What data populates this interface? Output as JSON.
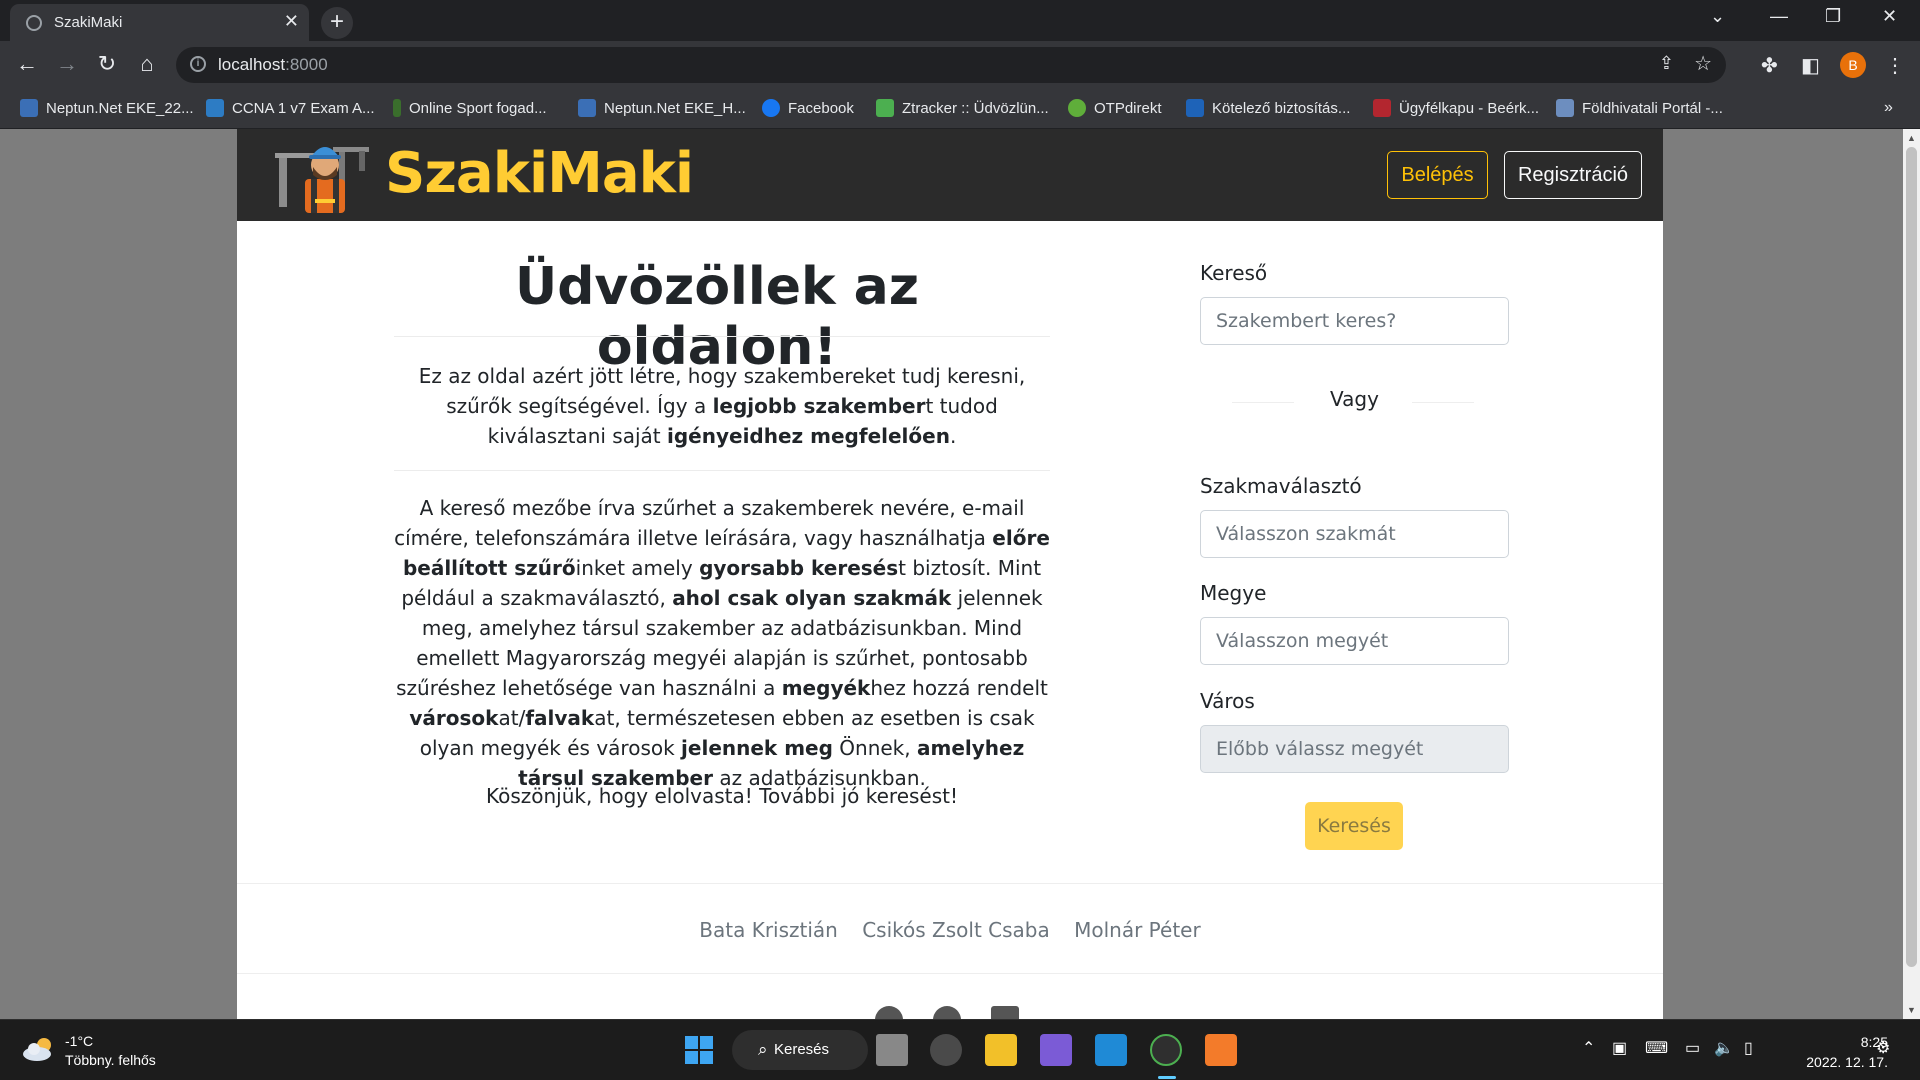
{
  "browser": {
    "tab_title": "SzakiMaki",
    "url_host": "localhost",
    "url_port": ":8000",
    "profile_initial": "B",
    "bookmarks": [
      "Neptun.Net EKE_22...",
      "CCNA 1 v7 Exam A...",
      "Online Sport fogad...",
      "Neptun.Net EKE_H...",
      "Facebook",
      "Ztracker :: Üdvözlün...",
      "OTPdirekt",
      "Kötelező biztosítás...",
      "Ügyfélkapu - Beérk...",
      "Földhivatali Portál -..."
    ]
  },
  "site": {
    "brand": "SzakiMaki",
    "nav": {
      "login": "Belépés",
      "register": "Regisztráció"
    },
    "welcome_title": "Üdvözöllek az oldalon!",
    "intro": {
      "t1": "Ez az oldal azért jött létre, hogy szakembereket tudj keresni, szűrők segítségével. Így a ",
      "b1": "legjobb szakember",
      "t2": "t tudod kiválasztani saját ",
      "b2": "igényeidhez megfelelően",
      "t3": "."
    },
    "details": {
      "t1": "A kereső mezőbe írva szűrhet a szakemberek nevére, e-mail címére, telefonszámára illetve leírására, vagy használhatja ",
      "b1": "előre beállított szűrő",
      "t2": "inket amely ",
      "b2": "gyorsabb keresés",
      "t3": "t biztosít. Mint például a szakmaválasztó, ",
      "b3": "ahol csak olyan szakmák",
      "t4": " jelennek meg, amelyhez társul szakember az adatbázisunkban. Mind emellett Magyarország megyéi alapján is szűrhet, pontosabb szűréshez lehetősége van használni a ",
      "b4": "megyék",
      "t5": "hez hozzá rendelt ",
      "b5": "városok",
      "t6": "at/",
      "b6": "falvak",
      "t7": "at, természetesen ebben az esetben is csak olyan megyék és városok ",
      "b7": "jelennek meg",
      "t8": " Önnek, ",
      "b8": "amelyhez társul szakember",
      "t9": " az adatbázisunkban."
    },
    "thanks": "Köszönjük, hogy elolvasta! További jó keresést!",
    "sidebar": {
      "search_label": "Kereső",
      "search_placeholder": "Szakembert keres?",
      "or": "Vagy",
      "profession_label": "Szakmaválasztó",
      "profession_placeholder": "Válasszon szakmát",
      "county_label": "Megye",
      "county_placeholder": "Válasszon megyét",
      "city_label": "Város",
      "city_placeholder": "Előbb válassz megyét",
      "search_button": "Keresés"
    },
    "footer": {
      "authors": [
        "Bata Krisztián",
        "Csikós Zsolt Csaba",
        "Molnár Péter"
      ]
    }
  },
  "taskbar": {
    "temperature": "-1°C",
    "weather": "Többny. felhős",
    "search": "Keresés",
    "time": "8:25",
    "date": "2022. 12. 17."
  },
  "colors": {
    "brand": "#ffcc33",
    "accent": "#ffc107",
    "navbar": "#2b2b2b"
  }
}
